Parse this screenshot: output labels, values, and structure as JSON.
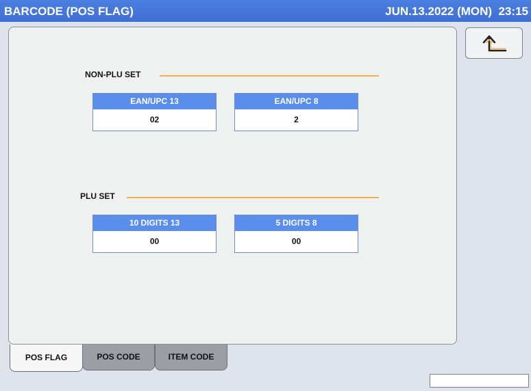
{
  "header": {
    "title": "BARCODE (POS FLAG)",
    "datetime": "JUN.13.2022 (MON)  23:15"
  },
  "back_button": {
    "icon": "return-arrow-icon"
  },
  "sections": {
    "non_plu": {
      "label": "NON-PLU SET",
      "fields": [
        {
          "label": "EAN/UPC 13",
          "value": "02"
        },
        {
          "label": "EAN/UPC 8",
          "value": "2"
        }
      ]
    },
    "plu": {
      "label": "PLU SET",
      "fields": [
        {
          "label": "10 DIGITS 13",
          "value": "00"
        },
        {
          "label": "5 DIGITS 8",
          "value": "00"
        }
      ]
    }
  },
  "tabs": [
    {
      "label": "POS FLAG",
      "active": true
    },
    {
      "label": "POS CODE",
      "active": false
    },
    {
      "label": "ITEM CODE",
      "active": false
    }
  ],
  "status": {
    "text": ""
  },
  "colors": {
    "title_bar": "#4c7fe0",
    "field_header": "#5a8eea",
    "section_line": "#f3b14d"
  }
}
